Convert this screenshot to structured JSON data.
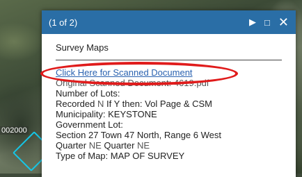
{
  "map": {
    "label": "002000"
  },
  "popup": {
    "counter": "(1 of 2)",
    "layer_title": "Survey Maps",
    "fields": {
      "link": "Click Here for Scanned Document",
      "original": "Original Scanned Document: 4619.pdf",
      "num_lots": "Number of Lots:",
      "recorded_label": "Recorded ",
      "recorded_value": "N",
      "recorded_rest": " If Y then: Vol Page & CSM",
      "municipality": "Municipality: KEYSTONE",
      "gov_lot": "Government Lot:",
      "section": "Section 27 Town 47 North, Range 6 West",
      "quarter_prefix": "Quarter ",
      "quarter_value": "NE",
      "quarter_mid": " Quarter ",
      "quarter_value2": "NE",
      "type_cut": "Type of Map: MAP OF SURVEY"
    },
    "buttons": {
      "next": "▶",
      "maximize": "□",
      "close": "✕"
    }
  },
  "colors": {
    "header": "#2a6ea6",
    "link": "#2a62b0",
    "annotation": "#e01b1b",
    "parcel_outline": "#16c6e6"
  }
}
